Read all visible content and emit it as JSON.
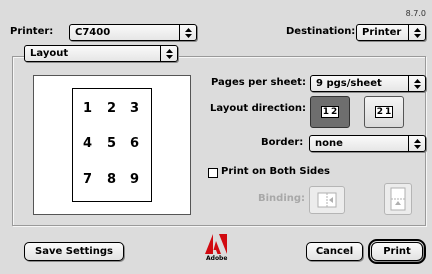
{
  "version": "8.7.0",
  "printer": {
    "label": "Printer:",
    "value": "C7400"
  },
  "destination": {
    "label": "Destination:",
    "value": "Printer"
  },
  "panel": {
    "value": "Layout"
  },
  "preview": {
    "numbers": [
      "1",
      "2",
      "3",
      "4",
      "5",
      "6",
      "7",
      "8",
      "9"
    ]
  },
  "pages_per_sheet": {
    "label": "Pages per sheet:",
    "value": "9 pgs/sheet"
  },
  "layout_direction": {
    "label": "Layout direction:",
    "option_a": [
      "1",
      "2"
    ],
    "option_b": [
      "2",
      "1"
    ]
  },
  "border": {
    "label": "Border:",
    "value": "none"
  },
  "both_sides": {
    "label": "Print on Both Sides",
    "checked": false
  },
  "binding": {
    "label": "Binding:"
  },
  "footer": {
    "save_settings": "Save Settings",
    "adobe_text": "Adobe",
    "cancel": "Cancel",
    "print": "Print"
  }
}
